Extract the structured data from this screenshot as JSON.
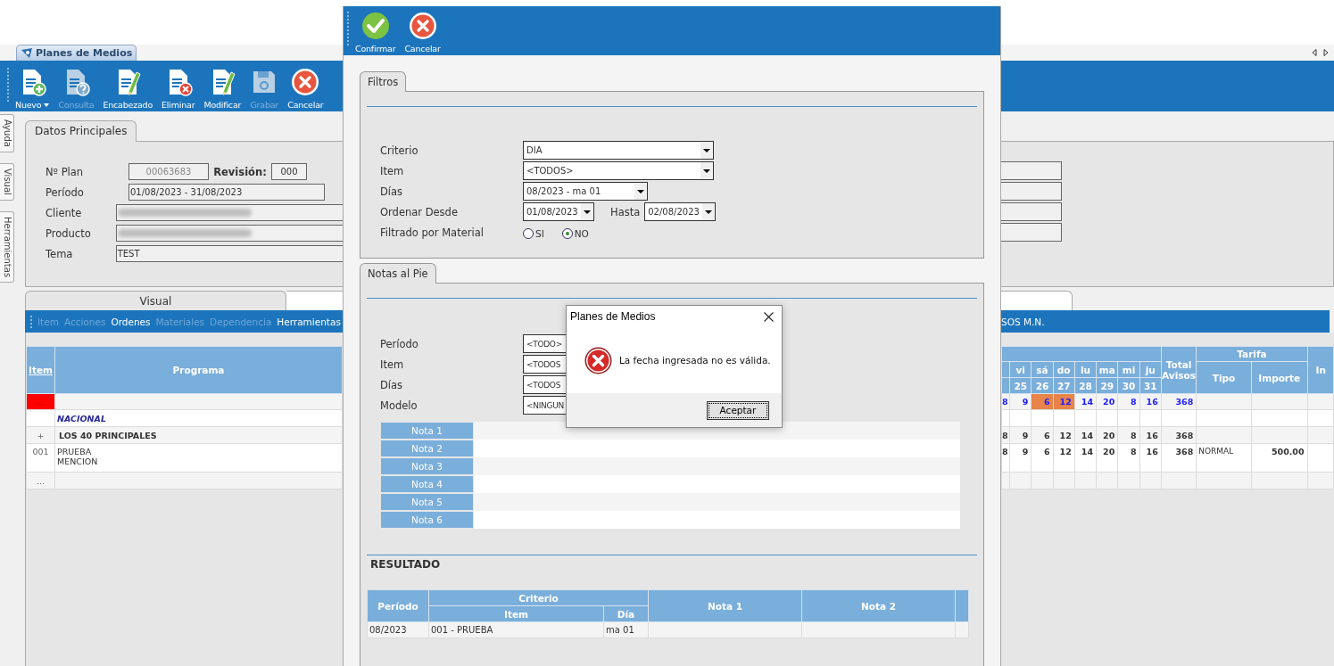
{
  "app_tab": {
    "title": "Planes de Medios"
  },
  "toolbar": [
    {
      "label": "Nuevo",
      "kind": "new",
      "disabled": false,
      "has_menu": true
    },
    {
      "label": "Consulta",
      "kind": "query",
      "disabled": true,
      "has_menu": false
    },
    {
      "label": "Encabezado",
      "kind": "edit",
      "disabled": false,
      "has_menu": false
    },
    {
      "label": "Eliminar",
      "kind": "delete",
      "disabled": false,
      "has_menu": false
    },
    {
      "label": "Modificar",
      "kind": "edit",
      "disabled": false,
      "has_menu": false
    },
    {
      "label": "Grabar",
      "kind": "save",
      "disabled": true,
      "has_menu": false
    },
    {
      "label": "Cancelar",
      "kind": "cancel",
      "disabled": false,
      "has_menu": false
    }
  ],
  "side_tabs": [
    "Ayuda",
    "Visual",
    "Herramientas"
  ],
  "datos": {
    "tab": "Datos Principales",
    "plan_label": "Nº Plan",
    "plan_value": "00063683",
    "revision_label": "Revisión:",
    "revision_value": "000",
    "fields": [
      {
        "label": "Período",
        "value": "01/08/2023 - 31/08/2023",
        "blurred": false
      },
      {
        "label": "Cliente",
        "blurred": true
      },
      {
        "label": "Producto",
        "blurred": true
      },
      {
        "label": "Tema",
        "value": "TEST",
        "blurred": false
      }
    ]
  },
  "view_tab": "Visual",
  "menu": [
    {
      "label": "Item",
      "disabled": true
    },
    {
      "label": "Acciones",
      "disabled": true
    },
    {
      "label": "Ordenes",
      "disabled": false
    },
    {
      "label": "Materiales",
      "disabled": true
    },
    {
      "label": "Dependencia",
      "disabled": true
    },
    {
      "label": "Herramientas",
      "disabled": false
    }
  ],
  "menu_right": "SOS M.N.",
  "grid": {
    "item_header": "Item",
    "programa_header": "Programa",
    "days": [
      {
        "dow": "vi",
        "num": "25"
      },
      {
        "dow": "sá",
        "num": "26"
      },
      {
        "dow": "do",
        "num": "27"
      },
      {
        "dow": "lu",
        "num": "28"
      },
      {
        "dow": "ma",
        "num": "29"
      },
      {
        "dow": "mi",
        "num": "30"
      },
      {
        "dow": "ju",
        "num": "31"
      }
    ],
    "total_header": "Total Avisos",
    "tarifa_header": "Tarifa",
    "tipo_header": "Tipo",
    "importe_header": "Importe",
    "cut_header": "In",
    "rows": [
      {
        "kind": "new",
        "item": "...",
        "values": [
          "8",
          "9",
          "6",
          "12",
          "14",
          "20",
          "8",
          "16"
        ],
        "total": "368",
        "marked": [
          false,
          false,
          true,
          true,
          false,
          false,
          false,
          false
        ]
      },
      {
        "kind": "group",
        "programa": [
          "NACIONAL"
        ]
      },
      {
        "kind": "program",
        "item": "+",
        "programa": [
          "LOS 40 PRINCIPALES"
        ],
        "values": [
          "8",
          "9",
          "6",
          "12",
          "14",
          "20",
          "8",
          "16"
        ],
        "total": "368"
      },
      {
        "kind": "detail",
        "item": "001",
        "programa": [
          "PRUEBA",
          "MENCION"
        ],
        "values": [
          "8",
          "9",
          "6",
          "12",
          "14",
          "20",
          "8",
          "16"
        ],
        "total": "368",
        "tipo": "NORMAL",
        "importe": "500.00"
      },
      {
        "kind": "blank",
        "item": "..."
      }
    ]
  },
  "dialog": {
    "toolbar": [
      {
        "label": "Confirmar",
        "kind": "confirm"
      },
      {
        "label": "Cancelar",
        "kind": "cancel"
      }
    ],
    "filtros": {
      "tab": "Filtros",
      "fields": [
        {
          "label": "Criterio",
          "kind": "select",
          "value": "DIA"
        },
        {
          "label": "Item",
          "kind": "select",
          "value": "<TODOS>"
        },
        {
          "label": "Días",
          "kind": "period",
          "value": "08/2023 - ma 01"
        },
        {
          "label": "Ordenar Desde",
          "kind": "range",
          "value": "01/08/2023",
          "to_label": "Hasta",
          "to_value": "02/08/2023"
        },
        {
          "label": "Filtrado por Material",
          "kind": "radio",
          "options": [
            {
              "label": "SI",
              "selected": false
            },
            {
              "label": "NO",
              "selected": true
            }
          ]
        }
      ]
    },
    "notas": {
      "tab": "Notas al Pie",
      "fields": [
        {
          "label": "Período",
          "value": "<TODO>"
        },
        {
          "label": "Item",
          "value": "<TODOS"
        },
        {
          "label": "Días",
          "value": "<TODOS"
        },
        {
          "label": "Modelo",
          "value": "<NINGUN"
        }
      ],
      "notes": [
        "Nota 1",
        "Nota 2",
        "Nota 3",
        "Nota 4",
        "Nota 5",
        "Nota 6"
      ]
    },
    "resultado": {
      "title": "RESULTADO",
      "periodo_header": "Período",
      "criterio_header": "Criterio",
      "item_header": "Item",
      "dia_header": "Día",
      "nota1_header": "Nota 1",
      "nota2_header": "Nota 2",
      "rows": [
        {
          "periodo": "08/2023",
          "item": "001 - PRUEBA",
          "dia": "ma 01"
        }
      ]
    }
  },
  "message_box": {
    "title": "Planes de Medios",
    "message": "La fecha ingresada no es válida.",
    "button": "Aceptar"
  }
}
